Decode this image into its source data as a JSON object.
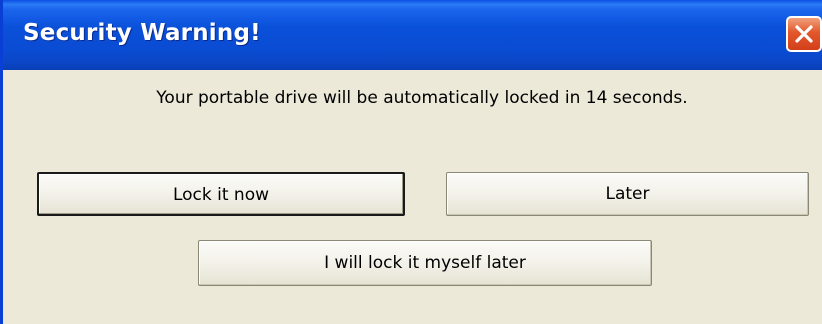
{
  "window": {
    "title": "Security Warning!",
    "close_icon": "close-icon"
  },
  "message": "Your portable drive will be automatically locked in 14 seconds.",
  "buttons": {
    "lock_now": "Lock it now",
    "later": "Later",
    "lock_myself": "I will lock it myself later"
  },
  "colors": {
    "titlebar": "#0a50d9",
    "close_button": "#e2572b",
    "dialog_background": "#ece9d8"
  }
}
